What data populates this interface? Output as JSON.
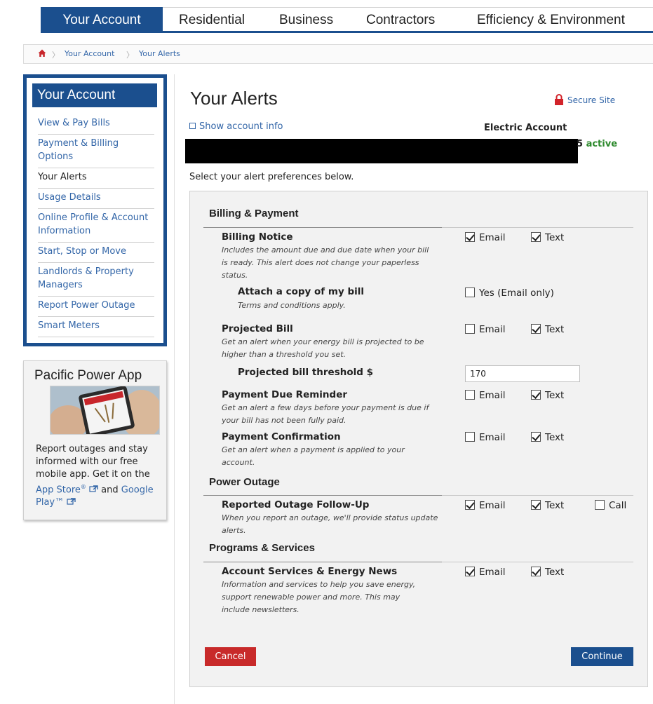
{
  "topnav": {
    "items": [
      {
        "label": "Your Account",
        "active": true
      },
      {
        "label": "Residential",
        "active": false
      },
      {
        "label": "Business",
        "active": false
      },
      {
        "label": "Contractors",
        "active": false
      },
      {
        "label": "Efficiency & Environment",
        "active": false
      }
    ]
  },
  "breadcrumb": {
    "home_icon": "home-icon",
    "items": [
      "Your Account",
      "Your Alerts"
    ]
  },
  "sidebar": {
    "title": "Your Account",
    "items": [
      {
        "label": "View & Pay Bills",
        "current": false
      },
      {
        "label": "Payment & Billing Options",
        "current": false
      },
      {
        "label": "Your Alerts",
        "current": true
      },
      {
        "label": "Usage Details",
        "current": false
      },
      {
        "label": "Online Profile & Account Information",
        "current": false
      },
      {
        "label": "Start, Stop or Move",
        "current": false
      },
      {
        "label": "Landlords & Property Managers",
        "current": false
      },
      {
        "label": "Report Power Outage",
        "current": false
      },
      {
        "label": "Smart Meters",
        "current": false
      }
    ]
  },
  "app_promo": {
    "title": "Pacific Power App",
    "text_line1": "Report outages and stay informed with our free mobile app. Get it on the",
    "app_store": "App Store",
    "app_store_sup": "®",
    "and": "and",
    "google_play": "Google Play™",
    "external_icon": "external-link-icon"
  },
  "main": {
    "title": "Your Alerts",
    "secure_site": "Secure Site",
    "show_account_info": "Show account info",
    "account_type": "Electric Account",
    "status_num": "5",
    "status": "active",
    "instructions": "Select your alert preferences below."
  },
  "sections": {
    "billing": {
      "title": "Billing & Payment",
      "billing_notice": {
        "name": "Billing Notice",
        "desc": "Includes the amount due and due date when your bill is ready. This alert does not change your paperless status.",
        "email": {
          "label": "Email",
          "checked": true
        },
        "text": {
          "label": "Text",
          "checked": true
        }
      },
      "attach_copy": {
        "name": "Attach a copy of my bill",
        "desc": "Terms and conditions apply.",
        "yes": {
          "label": "Yes (Email only)",
          "checked": false
        }
      },
      "projected_bill": {
        "name": "Projected Bill",
        "desc": "Get an alert when your energy bill is projected to be higher than a threshold you set.",
        "email": {
          "label": "Email",
          "checked": false
        },
        "text": {
          "label": "Text",
          "checked": true
        }
      },
      "threshold": {
        "name": "Projected bill threshold $",
        "value": "170"
      },
      "payment_due": {
        "name": "Payment Due Reminder",
        "desc": "Get an alert a few days before your payment is due if your bill has not been fully paid.",
        "email": {
          "label": "Email",
          "checked": false
        },
        "text": {
          "label": "Text",
          "checked": true
        }
      },
      "payment_confirmation": {
        "name": "Payment Confirmation",
        "desc": "Get an alert when a payment is applied to your account.",
        "email": {
          "label": "Email",
          "checked": false
        },
        "text": {
          "label": "Text",
          "checked": true
        }
      }
    },
    "outage": {
      "title": "Power Outage",
      "followup": {
        "name": "Reported Outage Follow-Up",
        "desc": "When you report an outage, we'll provide status update alerts.",
        "email": {
          "label": "Email",
          "checked": true
        },
        "text": {
          "label": "Text",
          "checked": true
        },
        "call": {
          "label": "Call",
          "checked": false
        }
      }
    },
    "programs": {
      "title": "Programs & Services",
      "news": {
        "name": "Account Services & Energy News",
        "desc": "Information and services to help you save energy, support renewable power and more. This may include newsletters.",
        "email": {
          "label": "Email",
          "checked": true
        },
        "text": {
          "label": "Text",
          "checked": true
        }
      }
    }
  },
  "buttons": {
    "cancel": "Cancel",
    "continue": "Continue"
  },
  "colors": {
    "brand_blue": "#1b4f8e",
    "link_blue": "#3366a8",
    "cancel_red": "#c82a2a",
    "active_green": "#2d8a2d"
  }
}
